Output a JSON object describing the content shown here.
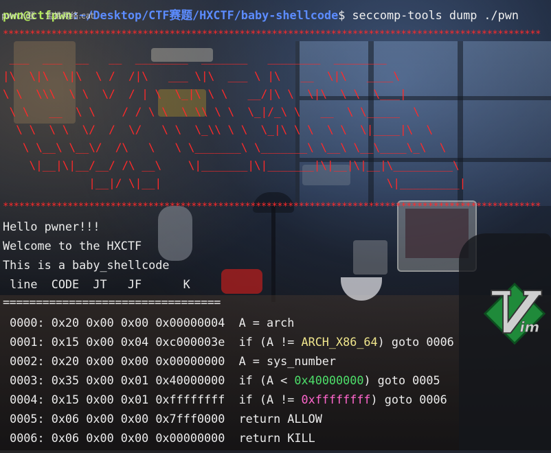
{
  "prompt": {
    "user": "pwn@ctfpwn",
    "path": ":~/Desktop/CTF赛题/HXCTF/baby-shellcode",
    "symbol": "$",
    "command": " seccomp-tools dump ./pwn"
  },
  "overlay_tab_text": "pwn入题    宝推网络.cat",
  "banner": {
    "border_line": "****************************************************************************************************",
    "ascii_rows": [
      " ___  ___  __   __  ________  _______   ________  ________",
      "|\\  \\|\\  \\|\\  \\ /  /|\\   ___ \\|\\  ___ \\ |\\   __  \\|\\   ____\\",
      "\\ \\  \\\\\\  \\ \\  \\/  / | \\  \\_|\\ \\ \\   __/|\\ \\  \\|\\  \\ \\  \\___|",
      " \\ \\   __  \\ \\    / / \\ \\  \\ \\\\ \\ \\  \\_|/_\\ \\   __  \\ \\_____  \\",
      "  \\ \\  \\ \\  \\/  /  \\/   \\ \\  \\_\\\\ \\ \\  \\_|\\ \\ \\  \\ \\  \\|____|\\  \\",
      "   \\ \\__\\ \\__\\/  /\\   \\   \\ \\_______\\ \\_______\\ \\__\\ \\__\\____\\_\\  \\",
      "    \\|__|\\|__/__/ /\\ __\\    \\|_______|\\|_______|\\|__|\\|__|\\_________\\",
      "             |__|/ \\|__|                                  \\|_________|"
    ]
  },
  "messages": {
    "hello": "Hello pwner!!!",
    "welcome": "Welcome to the HXCTF",
    "info": "This is a baby_shellcode"
  },
  "table": {
    "header": " line  CODE  JT   JF      K",
    "separator": "=================================",
    "rows": [
      {
        "line": " 0000:",
        "code": " 0x20",
        "jt": " 0x00",
        "jf": " 0x00",
        "k": " 0x00000004",
        "pre": "  A = arch",
        "hl": "",
        "post": ""
      },
      {
        "line": " 0001:",
        "code": " 0x15",
        "jt": " 0x00",
        "jf": " 0x04",
        "k": " 0xc000003e",
        "pre": "  if (A != ",
        "hl": "ARCH_X86_64",
        "post": ") goto 0006"
      },
      {
        "line": " 0002:",
        "code": " 0x20",
        "jt": " 0x00",
        "jf": " 0x00",
        "k": " 0x00000000",
        "pre": "  A = sys_number",
        "hl": "",
        "post": ""
      },
      {
        "line": " 0003:",
        "code": " 0x35",
        "jt": " 0x00",
        "jf": " 0x01",
        "k": " 0x40000000",
        "pre": "  if (A < ",
        "hl": "0x40000000",
        "post": ") goto 0005"
      },
      {
        "line": " 0004:",
        "code": " 0x15",
        "jt": " 0x00",
        "jf": " 0x01",
        "k": " 0xffffffff",
        "pre": "  if (A != ",
        "hl": "0xffffffff",
        "post": ") goto 0006"
      },
      {
        "line": " 0005:",
        "code": " 0x06",
        "jt": " 0x00",
        "jf": " 0x00",
        "k": " 0x7fff0000",
        "pre": "  return ALLOW",
        "hl": "",
        "post": ""
      },
      {
        "line": " 0006:",
        "code": " 0x06",
        "jt": " 0x00",
        "jf": " 0x00",
        "k": " 0x00000000",
        "pre": "  return KILL",
        "hl": "",
        "post": ""
      }
    ]
  },
  "vim_logo": {
    "icon": "vim-logo-icon",
    "text": "Vim"
  },
  "colors": {
    "banner_red": "#ff2a2a",
    "prompt_green": "#b2e85a",
    "prompt_blue": "#5c8cff",
    "highlight_yellow": "#f0e68c",
    "highlight_green": "#4ddf6a",
    "highlight_pink": "#ff66cc"
  }
}
